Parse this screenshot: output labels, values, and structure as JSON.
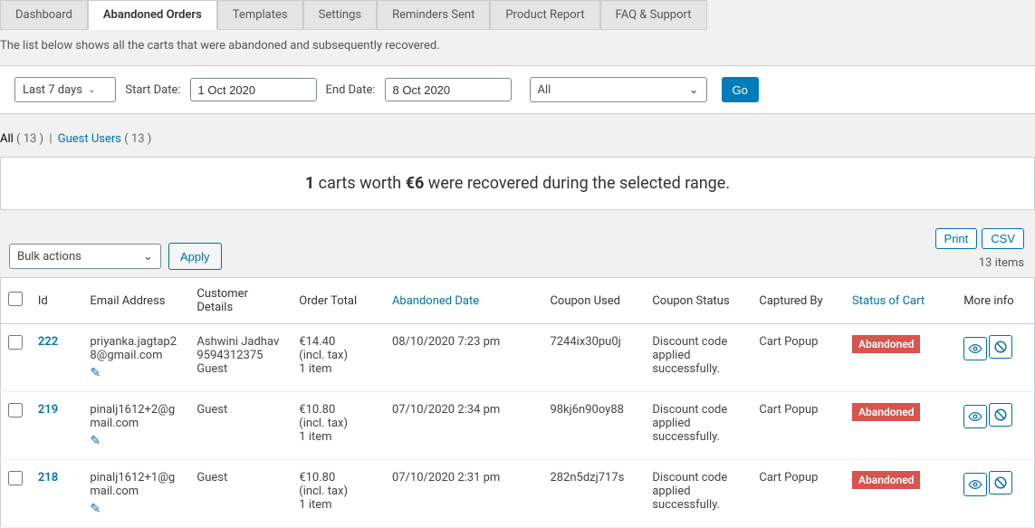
{
  "tabs": [
    "Dashboard",
    "Abandoned Orders",
    "Templates",
    "Settings",
    "Reminders Sent",
    "Product Report",
    "FAQ & Support"
  ],
  "active_tab": 1,
  "subheader": "The list below shows all the carts that were abandoned and subsequently recovered.",
  "filter": {
    "range": "Last 7 days",
    "start_label": "Start Date:",
    "start_value": "1 Oct 2020",
    "end_label": "End Date:",
    "end_value": "8 Oct 2020",
    "status": "All",
    "go": "Go"
  },
  "links": {
    "all": "All",
    "all_count": "( 13 )",
    "sep": "|",
    "guest": "Guest Users",
    "guest_count": "( 13 )"
  },
  "summary": {
    "count": "1",
    "mid1": " carts worth ",
    "amount": "€6",
    "mid2": " were recovered during the selected range."
  },
  "toolbar": {
    "bulk": "Bulk actions",
    "apply": "Apply",
    "print": "Print",
    "csv": "CSV",
    "items": "13 items"
  },
  "columns": {
    "id": "Id",
    "email": "Email Address",
    "customer": "Customer Details",
    "total": "Order Total",
    "date": "Abandoned Date",
    "coupon": "Coupon Used",
    "cstatus": "Coupon Status",
    "captured": "Captured By",
    "status": "Status of Cart",
    "more": "More info"
  },
  "rows": [
    {
      "id": "222",
      "email": "priyanka.jagtap28@gmail.com",
      "cust_line1": "Ashwini Jadhav",
      "cust_line2": "9594312375",
      "cust_line3": "Guest",
      "total_line1": "€14.40",
      "total_line2": "(incl. tax)",
      "total_line3": "1 item",
      "date": "08/10/2020 7:23 pm",
      "coupon": "7244ix30pu0j",
      "cstatus": "Discount code applied successfully.",
      "captured": "Cart Popup",
      "status": "Abandoned"
    },
    {
      "id": "219",
      "email": "pinalj1612+2@gmail.com",
      "cust_line1": "",
      "cust_line2": "",
      "cust_line3": "Guest",
      "total_line1": "€10.80",
      "total_line2": "(incl. tax)",
      "total_line3": "1 item",
      "date": "07/10/2020 2:34 pm",
      "coupon": "98kj6n90oy88",
      "cstatus": "Discount code applied successfully.",
      "captured": "Cart Popup",
      "status": "Abandoned"
    },
    {
      "id": "218",
      "email": "pinalj1612+1@gmail.com",
      "cust_line1": "",
      "cust_line2": "",
      "cust_line3": "Guest",
      "total_line1": "€10.80",
      "total_line2": "(incl. tax)",
      "total_line3": "1 item",
      "date": "07/10/2020 2:31 pm",
      "coupon": "282n5dzj717s",
      "cstatus": "Discount code applied successfully.",
      "captured": "Cart Popup",
      "status": "Abandoned"
    }
  ]
}
